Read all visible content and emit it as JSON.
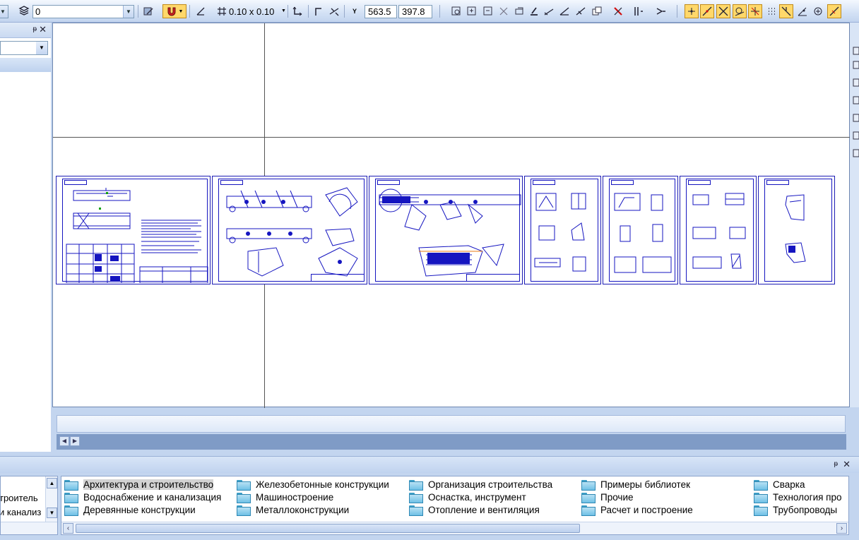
{
  "toolbar": {
    "layer_value": "0",
    "grid_step": "0.10 x 0.10",
    "cursor_x": "563.5",
    "cursor_y": "397.8",
    "coord_label": "Y"
  },
  "library": {
    "left_items": [
      "троитель",
      "и канализ"
    ],
    "folders": [
      "Архитектура и строительство",
      "Водоснабжение и канализация",
      "Деревянные конструкции",
      "Железобетонные конструкции",
      "Машиностроение",
      "Металлоконструкции",
      "Организация строительства",
      "Оснастка, инструмент",
      "Отопление и вентиляция",
      "Примеры библиотек",
      "Прочие",
      "Расчет и построение",
      "Сварка",
      "Технология про",
      "Трубопроводы"
    ],
    "selected_index": 0
  },
  "colors": {
    "drawing_blue": "#1515c0",
    "panel_blue": "#c3d5ef",
    "highlight": "#ffd86a"
  }
}
